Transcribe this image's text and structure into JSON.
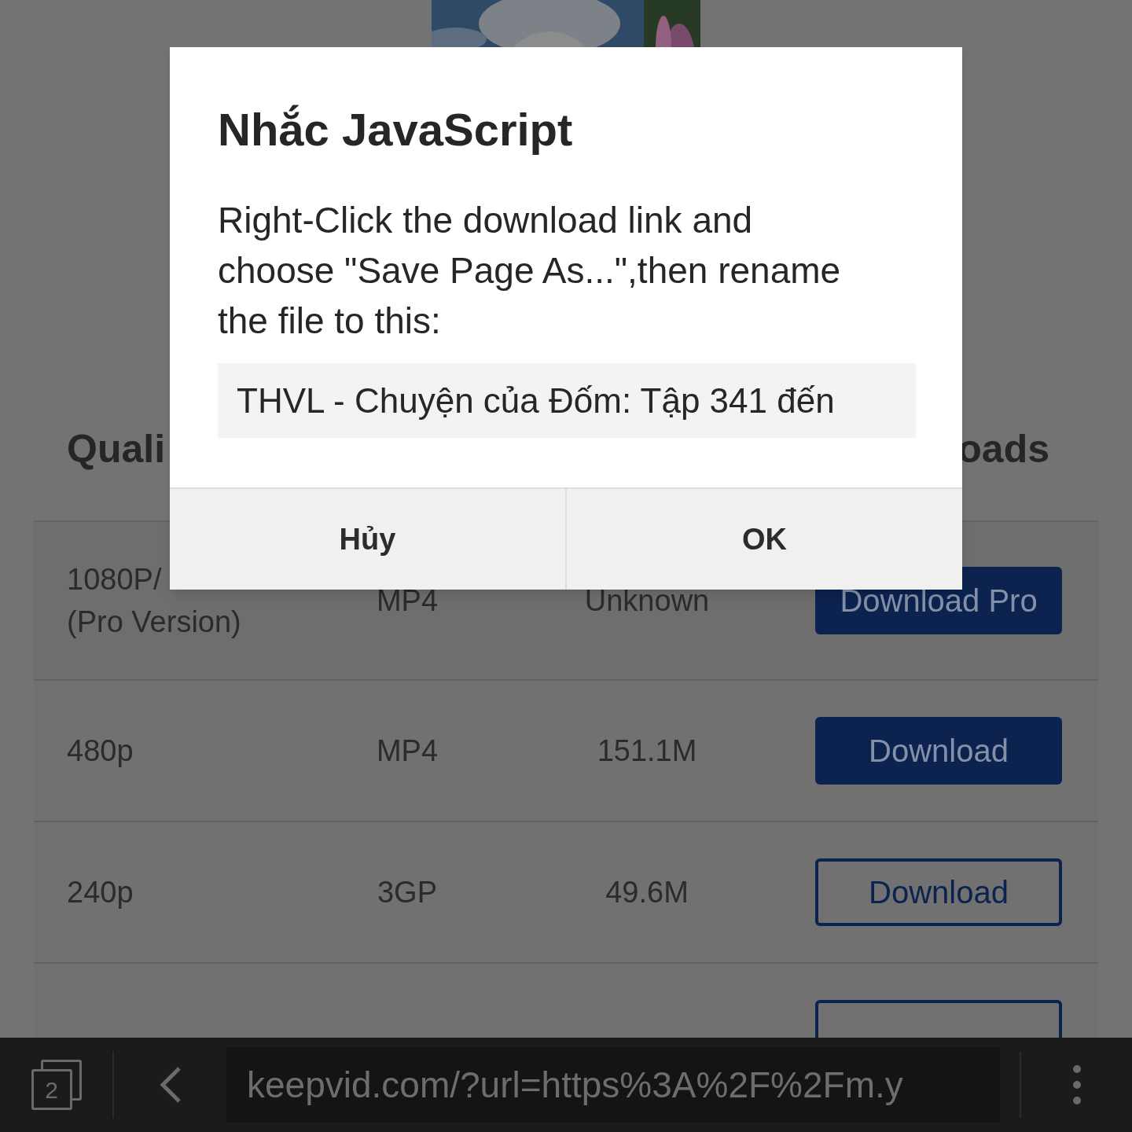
{
  "page": {
    "table": {
      "columns": [
        "Quali",
        "oads"
      ],
      "rows": [
        {
          "quality": [
            "1080P/",
            "(Pro Version)"
          ],
          "format": "MP4",
          "size": "Unknown",
          "action": {
            "label": "Download Pro",
            "kind": "filled"
          }
        },
        {
          "quality": [
            "480p"
          ],
          "format": "MP4",
          "size": "151.1M",
          "action": {
            "label": "Download",
            "kind": "filled"
          }
        },
        {
          "quality": [
            "240p"
          ],
          "format": "3GP",
          "size": "49.6M",
          "action": {
            "label": "Download",
            "kind": "outline"
          }
        },
        {
          "action": {
            "kind": "outline"
          }
        }
      ]
    }
  },
  "dialog": {
    "title": "Nhắc JavaScript",
    "message": "Right-Click the download link and choose \"Save Page As...\",then rename the file to this:",
    "value": "THVL - Chuyện của Đốm: Tập 341 đến",
    "buttons": [
      "Hủy",
      "OK"
    ]
  },
  "browser_bar": {
    "tab_count": "2",
    "url": "keepvid.com/?url=https%3A%2F%2Fm.y"
  }
}
